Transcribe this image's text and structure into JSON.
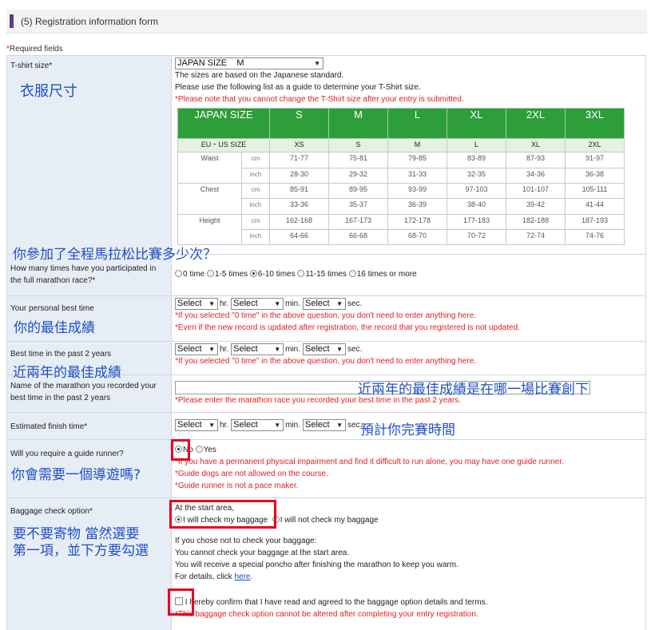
{
  "header": {
    "title": "(5)  Registration information form"
  },
  "required_note": {
    "mark": "*",
    "text": "Required fields"
  },
  "tshirt": {
    "label": "T-shirt size*",
    "select": "JAPAN SIZE    M",
    "line1": "The sizes are based on the Japanese standard.",
    "line2": "Please use the following list as a guide to determine your T-Shirt size.",
    "warning": "*Please note that you cannot change the T-Shirt size after your entry is submitted.",
    "size_table": {
      "header_jp": "JAPAN SIZE",
      "sizes_jp": [
        "S",
        "M",
        "L",
        "XL",
        "2XL",
        "3XL"
      ],
      "header_eu": "EU・US SIZE",
      "sizes_eu": [
        "XS",
        "S",
        "M",
        "L",
        "XL",
        "2XL"
      ],
      "rows": [
        {
          "cat": "Waist",
          "unit_cm": "cm",
          "cm": [
            "71-77",
            "75-81",
            "79-85",
            "83-89",
            "87-93",
            "91-97"
          ],
          "unit_in": "inch",
          "inch": [
            "28-30",
            "29-32",
            "31-33",
            "32-35",
            "34-36",
            "36-38"
          ]
        },
        {
          "cat": "Chest",
          "unit_cm": "cm",
          "cm": [
            "85-91",
            "89-95",
            "93-99",
            "97-103",
            "101-107",
            "105-111"
          ],
          "unit_in": "inch",
          "inch": [
            "33-36",
            "35-37",
            "36-39",
            "38-40",
            "39-42",
            "41-44"
          ]
        },
        {
          "cat": "Height",
          "unit_cm": "cm",
          "cm": [
            "162-168",
            "167-173",
            "172-178",
            "177-183",
            "182-188",
            "187-193"
          ],
          "unit_in": "inch",
          "inch": [
            "64-66",
            "66-68",
            "68-70",
            "70-72",
            "72-74",
            "74-76"
          ]
        }
      ]
    }
  },
  "marathon_count": {
    "label": "How many times have you participated in the full marathon race?*",
    "options": [
      "0 time",
      "1-5 times",
      "6-10 times",
      "11-15 times",
      "16 times or more"
    ],
    "selected_index": 2
  },
  "personal_best": {
    "label": "Your personal best time",
    "select_value": "Select",
    "units": [
      "hr.",
      "min.",
      "sec."
    ],
    "note1": "*If you selected \"0 time\" in the above question, you don't need to enter anything here.",
    "note2": "*Even if the new record is updated after registration, the record that you registered is not updated."
  },
  "best_2years": {
    "label": "Best time in the past 2 years",
    "select_value": "Select",
    "units": [
      "hr.",
      "min.",
      "sec."
    ],
    "note1": "*If you selected \"0 time\" in the above question, you don't need to enter anything here."
  },
  "marathon_name": {
    "label": "Name of the marathon you recorded your best time in the past 2 years",
    "input_value": "",
    "note1": "*Please enter the marathon race you recorded your best time in the past 2 years."
  },
  "finish_time": {
    "label": "Estimated finish time*",
    "select_value": "Select",
    "units": [
      "hr.",
      "min.",
      "sec."
    ]
  },
  "guide_runner": {
    "label": "Will you require a guide runner?",
    "options": [
      "No",
      "Yes"
    ],
    "selected_index": 0,
    "note1": "*If you have a permanent physical impairment and find it difficult to run alone, you may have one guide runner.",
    "note2": "*Guide dogs are not allowed on the course.",
    "note3": "*Guide runner is not a pace maker."
  },
  "baggage": {
    "label": "Baggage check option*",
    "area": "At the start area,",
    "options": [
      "I will check my baggage",
      "I will not check my baggage"
    ],
    "selected_index": 0,
    "info1": "If you chose not to check your baggage:",
    "info2": "You cannot check your baggage at the start area.",
    "info3": "You will receive a special poncho after finishing the marathon to keep you warm.",
    "info4_prefix": "For details, click ",
    "info4_link": "here",
    "info4_suffix": ".",
    "confirm": "I hereby confirm that I have read and agreed to the baggage option details and terms.",
    "note1": "*This baggage check option cannot be altered after completing your entry registration."
  },
  "annotations": {
    "clothes_size": "衣服尺寸",
    "how_many": "你參加了全程馬拉松比賽多少次？",
    "personal_best": "你的最佳成績",
    "best_2years": "近兩年的最佳成績",
    "which_race": "近兩年的最佳成績是在哪一場比賽創下",
    "finish_time": "預計你完賽時間",
    "guide_runner": "你會需要一個導遊嗎?",
    "baggage_1": "要不要寄物 當然選要",
    "baggage_2": "第一項，並下方要勾選"
  },
  "colors": {
    "annotation": "#1f4fc4",
    "highlight_box": "#e8001c",
    "table_header": "#2e9e3a",
    "label_bg": "#e6edf5",
    "warning": "#e21d1d"
  }
}
